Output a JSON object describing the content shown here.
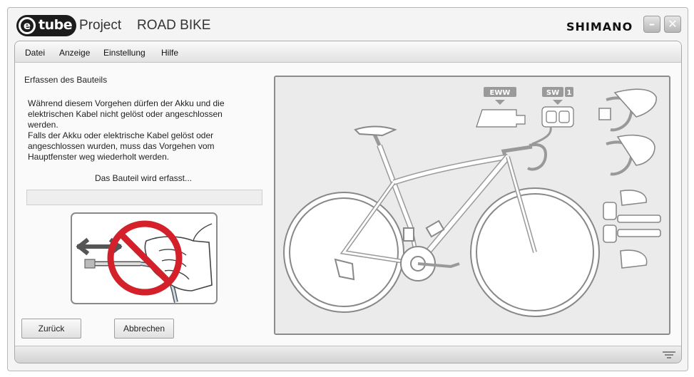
{
  "window": {
    "logo_e": "e",
    "logo_tube": "tube",
    "app_title": "Project",
    "bike_type": "ROAD BIKE",
    "brand": "SHIMANO",
    "minimize_icon": "minimize-icon",
    "close_icon": "close-icon"
  },
  "menu": {
    "items": [
      {
        "label": "Datei"
      },
      {
        "label": "Anzeige"
      },
      {
        "label": "Einstellung"
      },
      {
        "label": "Hilfe"
      }
    ]
  },
  "panel": {
    "section_title": "Erfassen des Bauteils",
    "info_lines": [
      "Während diesem Vorgehen dürfen der Akku und die",
      "elektrischen Kabel nicht gelöst oder angeschlossen",
      "werden.",
      "Falls der Akku oder elektrische Kabel gelöst oder",
      "angeschlossen wurden, muss das Vorgehen vom",
      "Hauptfenster weg wiederholt werden."
    ],
    "status_text": "Das Bauteil wird erfasst...",
    "progress_fraction": 0,
    "warning_icon": "no-disconnect-cable-icon"
  },
  "buttons": {
    "back_label": "Zurück",
    "cancel_label": "Abbrechen"
  },
  "diagram": {
    "eww_label": "EWW",
    "sw_label": "SW",
    "sw_count": "1",
    "bike_icon": "road-bike-icon"
  },
  "statusbar": {
    "grip_icon": "resize-grip-icon"
  }
}
